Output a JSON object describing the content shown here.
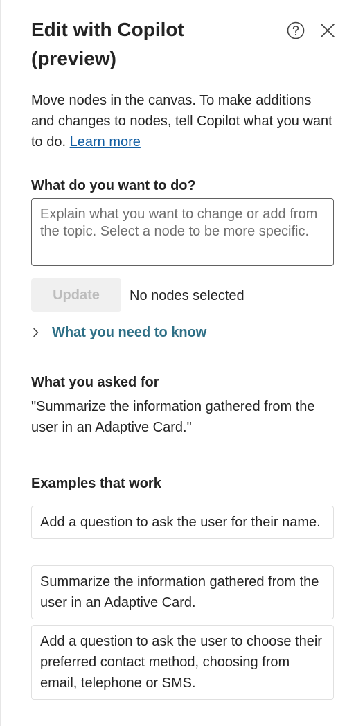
{
  "header": {
    "title_line1": "Edit with Copilot",
    "title_line2": "(preview)",
    "help_icon": "question-circle-icon",
    "close_icon": "close-icon"
  },
  "description": {
    "text": "Move nodes in the canvas. To make additions and changes to nodes, tell Copilot what you want to do. ",
    "link": "Learn more"
  },
  "prompt": {
    "label": "What do you want to do?",
    "placeholder": "Explain what you want to change or add from the topic. Select a node to be more specific.",
    "value": ""
  },
  "actions": {
    "update_label": "Update",
    "status": "No nodes selected"
  },
  "know": {
    "label": "What you need to know",
    "icon": "chevron-right-icon"
  },
  "asked": {
    "heading": "What you asked for",
    "text": "\"Summarize the information gathered from the user in an Adaptive Card.\""
  },
  "examples": {
    "heading": "Examples that work",
    "items": [
      "Add a question to ask the user for their name.",
      "Summarize the information gathered from the user in an Adaptive Card.",
      "Add a question to ask the user to choose their preferred contact method, choosing from email, telephone or SMS."
    ]
  },
  "colors": {
    "link": "#115ea3",
    "accent_teal": "#2e6f86",
    "disabled_bg": "#f0f0f0",
    "disabled_text": "#bdbdbd"
  }
}
